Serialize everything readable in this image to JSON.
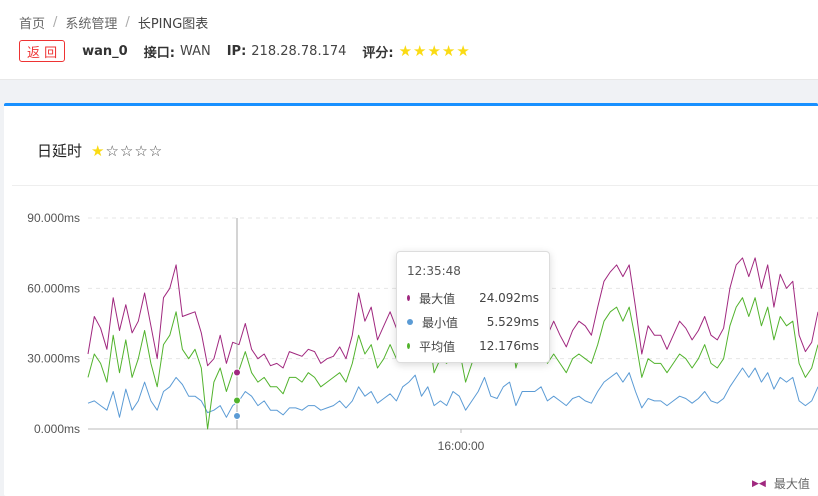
{
  "breadcrumb": {
    "home": "首页",
    "sep1": "/",
    "system": "系统管理",
    "sep2": "/",
    "current": "长PING图表"
  },
  "info": {
    "back_label": "返 回",
    "name": "wan_0",
    "interface_label": "接口:",
    "interface_value": "WAN",
    "ip_label": "IP:",
    "ip_value": "218.28.78.174",
    "rating_label": "评分:",
    "rating": "★★★★★"
  },
  "card": {
    "title": "日延时",
    "rating_filled": "★",
    "rating_empty": "☆☆☆☆"
  },
  "tooltip": {
    "time": "12:35:48",
    "rows": [
      {
        "label": "最大值",
        "value": "24.092ms",
        "color": "#a0287f"
      },
      {
        "label": "最小值",
        "value": "5.529ms",
        "color": "#5b9bd5"
      },
      {
        "label": "平均值",
        "value": "12.176ms",
        "color": "#52b32d"
      }
    ]
  },
  "legend": {
    "max_label": "最大值",
    "marker": "▶◀"
  },
  "colors": {
    "max": "#a0287f",
    "min": "#5b9bd5",
    "avg": "#52b32d",
    "accent": "#1890ff",
    "back": "#e33333",
    "star": "#fadb14"
  },
  "chart_data": {
    "type": "line",
    "ylim": [
      0,
      90
    ],
    "yticks": [
      "0.000ms",
      "30.000ms",
      "60.000ms",
      "90.000ms"
    ],
    "xticks": [
      "16:00:00"
    ],
    "series": [
      {
        "name": "最大值",
        "values": [
          32,
          48,
          43,
          34,
          56,
          42,
          53,
          41,
          46,
          58,
          44,
          30,
          56,
          60,
          70,
          48,
          49,
          50,
          41,
          27,
          30,
          40,
          28,
          37,
          36,
          45,
          34,
          30,
          32,
          27,
          28,
          26,
          33,
          32,
          31,
          34,
          33,
          28,
          30,
          31,
          35,
          30,
          40,
          58,
          46,
          52,
          38,
          44,
          50,
          43,
          55,
          60,
          68,
          48,
          62,
          36,
          43,
          40,
          52,
          48,
          30,
          40,
          50,
          62,
          45,
          43,
          56,
          65,
          37,
          50,
          50,
          52,
          54,
          40,
          46,
          40,
          35,
          42,
          46,
          44,
          40,
          52,
          63,
          67,
          70,
          65,
          70,
          52,
          32,
          44,
          40,
          40,
          34,
          40,
          46,
          43,
          38,
          42,
          48,
          40,
          38,
          43,
          60,
          70,
          73,
          65,
          73,
          60,
          70,
          52,
          66,
          60,
          63,
          40,
          33,
          37,
          50
        ]
      },
      {
        "name": "最小值",
        "values": [
          11,
          12,
          10,
          8,
          16,
          5,
          17,
          8,
          12,
          20,
          12,
          8,
          16,
          18,
          22,
          19,
          14,
          14,
          12,
          7,
          8,
          10,
          5,
          10,
          12,
          16,
          14,
          10,
          12,
          8,
          8,
          6,
          9,
          9,
          8,
          10,
          10,
          8,
          9,
          10,
          12,
          9,
          12,
          18,
          14,
          16,
          11,
          13,
          15,
          12,
          18,
          20,
          23,
          14,
          18,
          10,
          12,
          10,
          16,
          14,
          8,
          12,
          16,
          22,
          14,
          13,
          18,
          20,
          10,
          16,
          16,
          16,
          18,
          12,
          14,
          12,
          10,
          13,
          14,
          12,
          11,
          16,
          20,
          22,
          24,
          20,
          24,
          16,
          9,
          13,
          12,
          12,
          10,
          12,
          14,
          13,
          11,
          13,
          16,
          12,
          11,
          13,
          18,
          22,
          26,
          22,
          26,
          20,
          24,
          17,
          22,
          20,
          22,
          12,
          10,
          12,
          18
        ]
      },
      {
        "name": "平均值",
        "values": [
          22,
          32,
          28,
          20,
          40,
          24,
          38,
          22,
          30,
          42,
          28,
          18,
          36,
          40,
          50,
          34,
          30,
          34,
          26,
          0,
          20,
          26,
          16,
          24,
          25,
          33,
          24,
          20,
          22,
          18,
          18,
          15,
          22,
          22,
          20,
          24,
          22,
          18,
          20,
          22,
          24,
          20,
          28,
          40,
          32,
          36,
          26,
          30,
          36,
          30,
          40,
          44,
          50,
          34,
          44,
          24,
          30,
          28,
          36,
          34,
          20,
          28,
          36,
          46,
          32,
          30,
          40,
          46,
          26,
          36,
          36,
          38,
          38,
          28,
          32,
          28,
          24,
          30,
          32,
          30,
          28,
          36,
          46,
          50,
          52,
          46,
          52,
          38,
          22,
          30,
          28,
          28,
          24,
          28,
          32,
          30,
          26,
          30,
          36,
          28,
          26,
          30,
          44,
          52,
          56,
          48,
          56,
          44,
          52,
          38,
          48,
          44,
          46,
          28,
          22,
          26,
          36
        ]
      }
    ]
  }
}
